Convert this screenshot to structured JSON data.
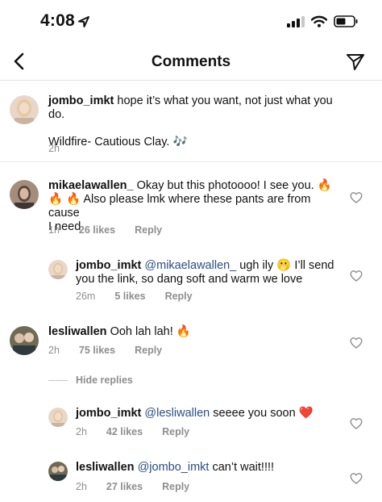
{
  "status": {
    "time": "4:08"
  },
  "nav": {
    "title": "Comments"
  },
  "comments": [
    {
      "user": "jombo_imkt",
      "text_line1": "hope it’s what you want, not just what you do.",
      "text_line2": "Wildfire- Cautious Clay. 🎶",
      "time": "2h"
    },
    {
      "user": "mikaelawallen_",
      "text_line1": "Okay but this photoooo! I see you. 🔥",
      "text_line2": "🔥 🔥 Also please lmk where these pants are from cause",
      "text_line3": "I need",
      "time": "1h",
      "likes": "26 likes",
      "reply": "Reply"
    },
    {
      "user": "jombo_imkt",
      "mention": "@mikaelawallen_",
      "text_line1_rest": "ugh ily 🫢 I’ll send",
      "text_line2": "you the link, so dang soft and warm we love",
      "time": "26m",
      "likes": "5 likes",
      "reply": "Reply"
    },
    {
      "user": "lesliwallen",
      "text_line1": "Ooh lah lah! 🔥",
      "time": "2h",
      "likes": "75 likes",
      "reply": "Reply"
    },
    {
      "user": "jombo_imkt",
      "mention": "@lesliwallen",
      "text_line1_rest": "seeee you soon ❤️",
      "time": "2h",
      "likes": "42 likes",
      "reply": "Reply"
    },
    {
      "user": "lesliwallen",
      "mention": "@jombo_imkt",
      "text_line1_rest": " can’t wait!!!!",
      "time": "2h",
      "likes": "27 likes",
      "reply": "Reply"
    }
  ],
  "hide_replies": "Hide replies",
  "icons": {
    "back": "chevron-left-icon",
    "send": "paper-plane-icon",
    "like": "heart-outline-icon"
  }
}
